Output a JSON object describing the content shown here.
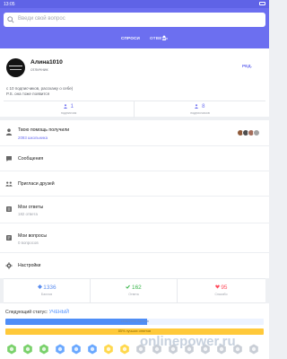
{
  "statusbar": {
    "time": "13:05"
  },
  "colors": {
    "accent": "#6c6ff0",
    "status": "#5f63e6",
    "green": "#39b54a",
    "red": "#ff4b5c",
    "blue": "#4f8ef7",
    "yellow": "#ffc93a"
  },
  "search": {
    "placeholder": "Введи свой вопрос",
    "icon": "search-icon"
  },
  "tabs": [
    {
      "label": "СПРОСИ",
      "active": true
    },
    {
      "label": "ОТВЕТЬ",
      "active": false
    },
    {
      "label": "",
      "icon": "user-icon",
      "active": false
    }
  ],
  "profile": {
    "username": "Алина1010",
    "rank": "отличник",
    "edit_label": "РЕД.",
    "bio_line1": "с 10 подписчиков, расскажу о себе)",
    "bio_line2": "P.S. она тоже появится",
    "followers": {
      "value": "1",
      "label": "подписчик",
      "icon": "people-icon"
    },
    "following": {
      "value": "8",
      "label": "подписчиков",
      "icon": "people-icon"
    }
  },
  "menu": {
    "help_received": {
      "title": "Твою помощь получили",
      "sub": "2093 школьника"
    },
    "messages": {
      "title": "Сообщения"
    },
    "invite": {
      "title": "Пригласи друзей"
    },
    "answers": {
      "title": "Мои ответы",
      "sub": "182 ответа"
    },
    "questions": {
      "title": "Мои вопросы",
      "sub": "0 вопросов"
    },
    "settings": {
      "title": "Настройки"
    }
  },
  "stats": [
    {
      "value": "1336",
      "label": "Баллов",
      "icon": "diamond-icon"
    },
    {
      "value": "162",
      "label": "Ответа",
      "icon": "check-icon"
    },
    {
      "value": "95",
      "label": "Спасибо",
      "icon": "heart-icon"
    }
  ],
  "next_status": {
    "label": "Следующий статус:",
    "value": "УЧЕНЫЙ",
    "points_progress": 0.55,
    "points_text": "1336/2000 баллов",
    "best_progress": 1.0,
    "best_text": "85% лучших ответов"
  },
  "badges": [
    "hex-green-badge",
    "hex-green-badge",
    "hex-green-badge",
    "hex-blue-badge",
    "hex-blue-badge",
    "hex-blue-badge",
    "hex-yellow-badge",
    "hex-yellow-badge",
    "hex-gray-badge",
    "hex-gray-badge",
    "hex-gray-badge",
    "hex-gray-badge",
    "hex-gray-badge",
    "hex-gray-badge",
    "hex-gray-badge",
    "hex-gray-badge"
  ],
  "watermark": "onlinepower.ru"
}
